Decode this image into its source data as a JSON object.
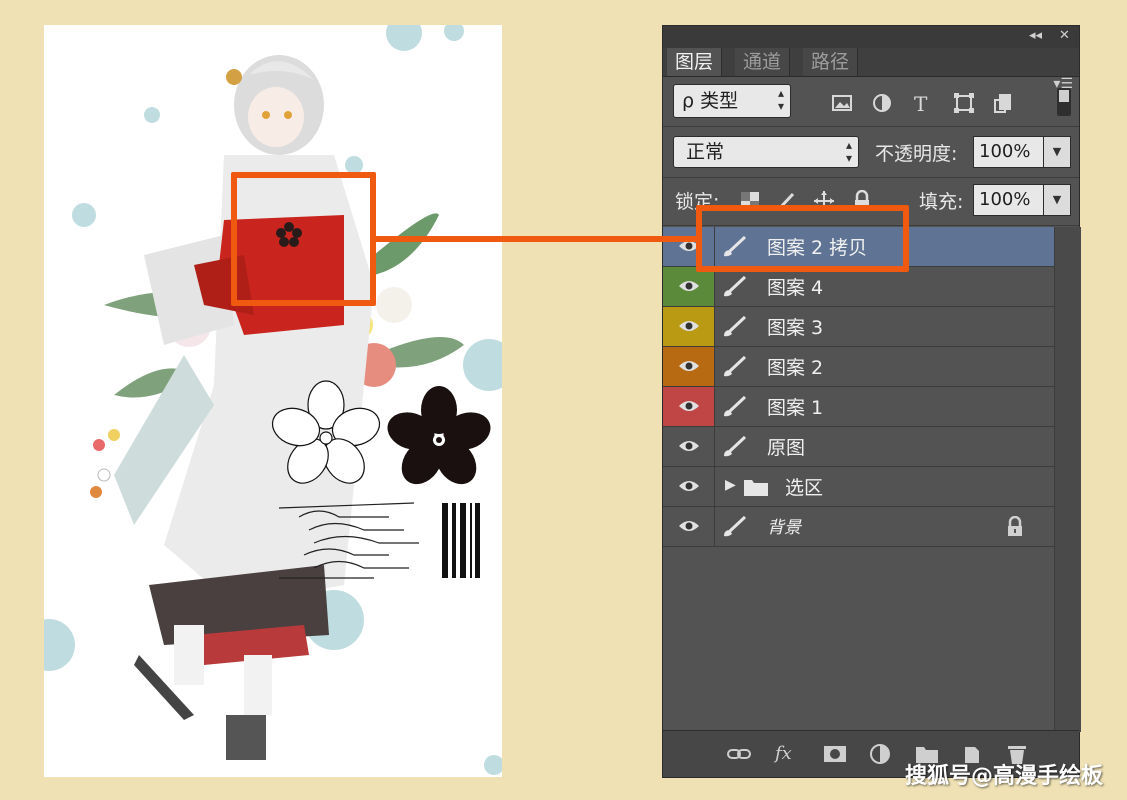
{
  "panel": {
    "tabs": [
      {
        "label": "图层",
        "active": true
      },
      {
        "label": "通道",
        "active": false
      },
      {
        "label": "路径",
        "active": false
      }
    ],
    "filter_kind": "ρ 类型",
    "blend_mode": "正常",
    "opacity_label": "不透明度:",
    "opacity_value": "100%",
    "lock_label": "锁定:",
    "fill_label": "填充:",
    "fill_value": "100%",
    "layers": [
      {
        "name": "图案 2 拷贝",
        "eye_color": "#535353",
        "selected": true
      },
      {
        "name": "图案 4",
        "eye_color": "#5b8a3a"
      },
      {
        "name": "图案 3",
        "eye_color": "#b99a12"
      },
      {
        "name": "图案 2",
        "eye_color": "#b76a12"
      },
      {
        "name": "图案 1",
        "eye_color": "#c04545"
      },
      {
        "name": "原图",
        "eye_color": "#535353"
      },
      {
        "name": "选区",
        "eye_color": "#535353",
        "is_group": true
      },
      {
        "name": "背景",
        "eye_color": "#535353",
        "locked": true
      }
    ],
    "bottom_icons": [
      "link-icon",
      "fx-icon",
      "mask-icon",
      "adjustment-icon",
      "folder-icon",
      "new-layer-icon",
      "trash-icon"
    ],
    "bottom_fx_label": "fx"
  },
  "colors": {
    "background": "#efe1b4",
    "callout": "#ef5a10",
    "selected_layer": "#5f7394"
  },
  "watermark": "搜狐号@高漫手绘板"
}
